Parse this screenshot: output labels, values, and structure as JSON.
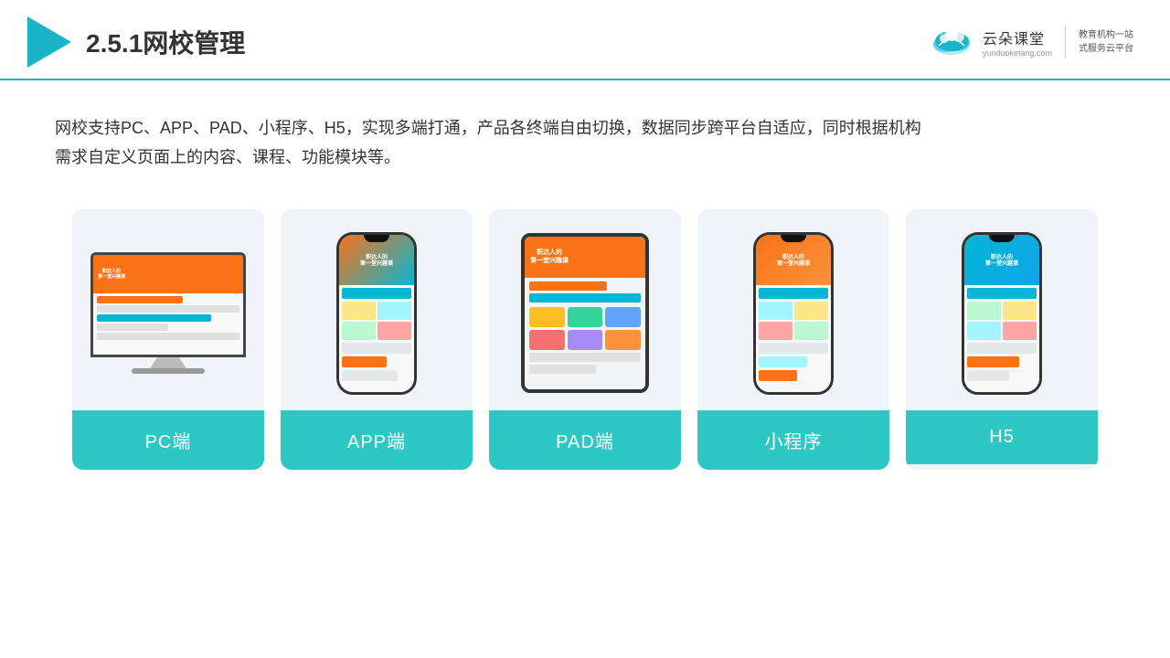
{
  "header": {
    "title": "2.5.1网校管理",
    "brand_name": "云朵课堂",
    "brand_url": "yunduoketang.com",
    "brand_slogan_line1": "教育机构一站",
    "brand_slogan_line2": "式服务云平台"
  },
  "description": {
    "text": "网校支持PC、APP、PAD、小程序、H5，实现多端打通，产品各终端自由切换，数据同步跨平台自适应，同时根据机构需求自定义页面上的内容、课程、功能模块等。"
  },
  "cards": [
    {
      "id": "pc",
      "label": "PC端",
      "type": "pc"
    },
    {
      "id": "app",
      "label": "APP端",
      "type": "phone"
    },
    {
      "id": "pad",
      "label": "PAD端",
      "type": "tablet"
    },
    {
      "id": "miniapp",
      "label": "小程序",
      "type": "phone2"
    },
    {
      "id": "h5",
      "label": "H5",
      "type": "phone3"
    }
  ]
}
